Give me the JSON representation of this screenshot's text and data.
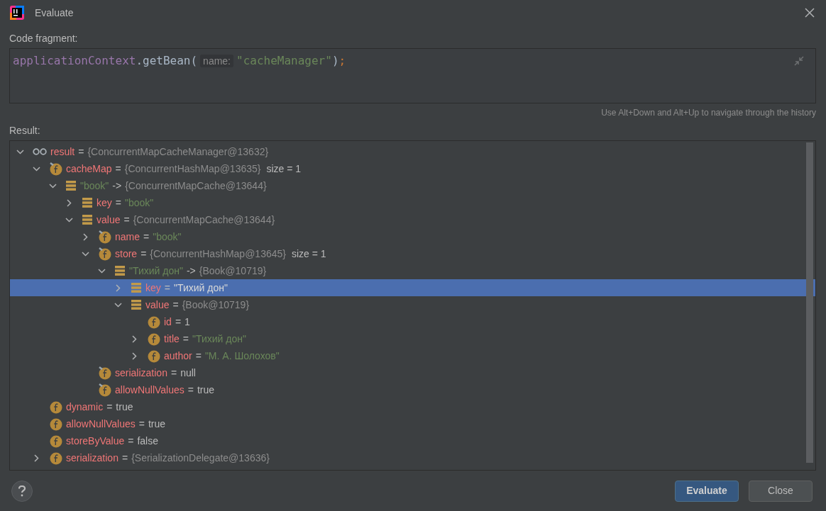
{
  "window": {
    "title": "Evaluate"
  },
  "code_fragment": {
    "label": "Code fragment:",
    "tokens": [
      {
        "kind": "identifier",
        "text": "applicationContext"
      },
      {
        "kind": "plain",
        "text": ".getBean("
      },
      {
        "kind": "hint",
        "text": "name:"
      },
      {
        "kind": "string",
        "text": "\"cacheManager\""
      },
      {
        "kind": "plain",
        "text": ")"
      },
      {
        "kind": "keyword",
        "text": ";"
      }
    ]
  },
  "history_hint": "Use Alt+Down and Alt+Up to navigate through the history",
  "result": {
    "label": "Result:",
    "tree": [
      {
        "kind": "watch",
        "expanded": true,
        "selected": false,
        "name": {
          "kind": "field",
          "text": "result"
        },
        "op": "=",
        "value": {
          "kind": "object",
          "text": "{ConcurrentMapCacheManager@13632}"
        },
        "children": [
          {
            "kind": "field",
            "pinned": true,
            "expanded": true,
            "selected": false,
            "name": {
              "kind": "field",
              "text": "cacheMap"
            },
            "op": "=",
            "value": {
              "kind": "object",
              "text": "{ConcurrentHashMap@13635}"
            },
            "extra": "size = 1",
            "children": [
              {
                "kind": "entry",
                "expanded": true,
                "selected": false,
                "name": {
                  "kind": "string",
                  "text": "\"book\""
                },
                "op": "->",
                "value": {
                  "kind": "object",
                  "text": "{ConcurrentMapCache@13644}"
                },
                "children": [
                  {
                    "kind": "entry",
                    "expanded": false,
                    "selected": false,
                    "name": {
                      "kind": "field",
                      "text": "key"
                    },
                    "op": "=",
                    "value": {
                      "kind": "string",
                      "text": "\"book\""
                    }
                  },
                  {
                    "kind": "entry",
                    "expanded": true,
                    "selected": false,
                    "name": {
                      "kind": "field",
                      "text": "value"
                    },
                    "op": "=",
                    "value": {
                      "kind": "object",
                      "text": "{ConcurrentMapCache@13644}"
                    },
                    "children": [
                      {
                        "kind": "field",
                        "pinned": true,
                        "expanded": false,
                        "selected": false,
                        "name": {
                          "kind": "field",
                          "text": "name"
                        },
                        "op": "=",
                        "value": {
                          "kind": "string",
                          "text": "\"book\""
                        }
                      },
                      {
                        "kind": "field",
                        "pinned": true,
                        "expanded": true,
                        "selected": false,
                        "name": {
                          "kind": "field",
                          "text": "store"
                        },
                        "op": "=",
                        "value": {
                          "kind": "object",
                          "text": "{ConcurrentHashMap@13645}"
                        },
                        "extra": "size = 1",
                        "children": [
                          {
                            "kind": "entry",
                            "expanded": true,
                            "selected": false,
                            "name": {
                              "kind": "string",
                              "text": "\"Тихий дон\""
                            },
                            "op": "->",
                            "value": {
                              "kind": "object",
                              "text": "{Book@10719}"
                            },
                            "children": [
                              {
                                "kind": "entry",
                                "expanded": false,
                                "selected": true,
                                "name": {
                                  "kind": "field",
                                  "text": "key"
                                },
                                "op": "=",
                                "value": {
                                  "kind": "string",
                                  "text": "\"Тихий дон\""
                                }
                              },
                              {
                                "kind": "entry",
                                "expanded": true,
                                "selected": false,
                                "name": {
                                  "kind": "field",
                                  "text": "value"
                                },
                                "op": "=",
                                "value": {
                                  "kind": "object",
                                  "text": "{Book@10719}"
                                },
                                "children": [
                                  {
                                    "kind": "field",
                                    "pinned": false,
                                    "selected": false,
                                    "name": {
                                      "kind": "field",
                                      "text": "id"
                                    },
                                    "op": "=",
                                    "value": {
                                      "kind": "plain",
                                      "text": "1"
                                    }
                                  },
                                  {
                                    "kind": "field",
                                    "pinned": false,
                                    "expanded": false,
                                    "selected": false,
                                    "name": {
                                      "kind": "field",
                                      "text": "title"
                                    },
                                    "op": "=",
                                    "value": {
                                      "kind": "string",
                                      "text": "\"Тихий дон\""
                                    }
                                  },
                                  {
                                    "kind": "field",
                                    "pinned": false,
                                    "expanded": false,
                                    "selected": false,
                                    "name": {
                                      "kind": "field",
                                      "text": "author"
                                    },
                                    "op": "=",
                                    "value": {
                                      "kind": "string",
                                      "text": "\"М. А. Шолохов\""
                                    }
                                  }
                                ]
                              }
                            ]
                          }
                        ]
                      },
                      {
                        "kind": "field",
                        "pinned": true,
                        "selected": false,
                        "name": {
                          "kind": "field",
                          "text": "serialization"
                        },
                        "op": "=",
                        "value": {
                          "kind": "plain",
                          "text": "null"
                        }
                      },
                      {
                        "kind": "field",
                        "pinned": true,
                        "selected": false,
                        "name": {
                          "kind": "field",
                          "text": "allowNullValues"
                        },
                        "op": "=",
                        "value": {
                          "kind": "plain",
                          "text": "true"
                        }
                      }
                    ]
                  }
                ]
              }
            ]
          },
          {
            "kind": "field",
            "pinned": false,
            "selected": false,
            "name": {
              "kind": "field",
              "text": "dynamic"
            },
            "op": "=",
            "value": {
              "kind": "plain",
              "text": "true"
            }
          },
          {
            "kind": "field",
            "pinned": false,
            "selected": false,
            "name": {
              "kind": "field",
              "text": "allowNullValues"
            },
            "op": "=",
            "value": {
              "kind": "plain",
              "text": "true"
            }
          },
          {
            "kind": "field",
            "pinned": false,
            "selected": false,
            "name": {
              "kind": "field",
              "text": "storeByValue"
            },
            "op": "=",
            "value": {
              "kind": "plain",
              "text": "false"
            }
          },
          {
            "kind": "field",
            "pinned": false,
            "expanded": false,
            "selected": false,
            "name": {
              "kind": "field",
              "text": "serialization"
            },
            "op": "=",
            "value": {
              "kind": "object",
              "text": "{SerializationDelegate@13636}"
            }
          }
        ]
      }
    ]
  },
  "buttons": [
    {
      "label": "Evaluate",
      "primary": true
    },
    {
      "label": "Close",
      "primary": false
    }
  ]
}
